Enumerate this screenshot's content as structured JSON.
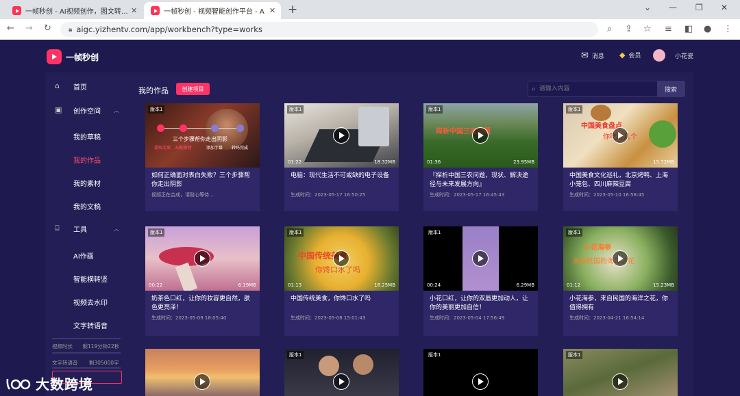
{
  "browser": {
    "tabs": [
      {
        "title": "一帧秒创 - AI视频创作，图文转…"
      },
      {
        "title": "一帧秒创 - 视频智能创作平台 - A"
      }
    ],
    "url": "aigc.yizhentv.com/app/workbench?type=works"
  },
  "app": {
    "brand": "一帧秒创",
    "header": {
      "messages": "消息",
      "member": "会员",
      "username": "小花瓷"
    },
    "sidebar": {
      "home": "首页",
      "creation_space": "创作空间",
      "creation_items": [
        "我的草稿",
        "我的作品",
        "我的素材",
        "我的文稿"
      ],
      "tools": "工具",
      "tool_items": [
        "AI作画",
        "智能横转竖",
        "视频去水印",
        "文字转语音"
      ],
      "quota": [
        {
          "label": "视频时长",
          "value": "剩119分钟22秒"
        },
        {
          "label": "文字转语音",
          "value": "剩305000字"
        }
      ]
    },
    "main": {
      "title": "我的作品",
      "create_button": "创建项目",
      "search_placeholder": "请输入内容",
      "search_button": "搜索"
    },
    "cards": [
      {
        "badge": "版本1",
        "duration": "",
        "size": "",
        "title": "如何正确面对表白失败？三个步骤帮你走出阴影",
        "meta": "视频正在合成，请耐心等待…",
        "overlay_lines": [
          "三个步骤帮你走出阴影"
        ],
        "steps": [
          "提取文案",
          "AI配素材",
          "添加字幕",
          "转码完成"
        ]
      },
      {
        "badge": "版本1",
        "duration": "01:22",
        "size": "18.32MB",
        "title": "电脑：现代生活不可或缺的电子设备",
        "meta": "生成时间：2023-05-17 16:50:25",
        "overlay_lines": []
      },
      {
        "badge": "版本1",
        "duration": "01:36",
        "size": "23.95MB",
        "title": "『探析中国三农问题，现状、解决途径与未来发展方向』",
        "meta": "生成时间：2023-05-17 16:45:43",
        "overlay_lines": [
          "探析中国三农问题"
        ]
      },
      {
        "badge": "版本1",
        "duration": "",
        "size": "15.72MB",
        "title": "中国美食文化巡礼，北京烤鸭、上海小笼包、四川麻辣豆腐",
        "meta": "生成时间：2023-05-10 16:58:45",
        "overlay_lines": [
          "中国美食盘点",
          "你吃过几个"
        ]
      },
      {
        "badge": "版本1",
        "duration": "00:22",
        "size": "6.19MB",
        "title": "奶茶色口红，让你的妆容更自然，肤色更亮泽！",
        "meta": "生成时间：2023-05-09 18:05:40",
        "overlay_lines": []
      },
      {
        "badge": "版本1",
        "duration": "01:13",
        "size": "18.25MB",
        "title": "中国传统美食，你馋口水了吗",
        "meta": "生成时间：2023-05-08 15:01:43",
        "overlay_lines": [
          "中国传统美食",
          "你馋口水了吗"
        ]
      },
      {
        "badge": "版本1",
        "duration": "00:24",
        "size": "6.29MB",
        "title": "小花口红，让你的双唇更加动人，让你的美丽更加自信！",
        "meta": "生成时间：2023-05-04 17:56:49",
        "overlay_lines": []
      },
      {
        "badge": "版本1",
        "duration": "01:12",
        "size": "15.23MB",
        "title": "小花海参，来自民国的海洋之花，你值得拥有",
        "meta": "生成时间：2023-04-21 16:54:14",
        "overlay_lines": [
          "小花海参",
          "来自民国的海洋之花"
        ]
      },
      {
        "badge": "",
        "duration": "",
        "size": "",
        "title": "",
        "meta": "",
        "overlay_lines": []
      },
      {
        "badge": "版本1",
        "duration": "",
        "size": "",
        "title": "",
        "meta": "",
        "overlay_lines": []
      },
      {
        "badge": "版本1",
        "duration": "",
        "size": "",
        "title": "",
        "meta": "",
        "overlay_lines": []
      },
      {
        "badge": "版本1",
        "duration": "",
        "size": "",
        "title": "",
        "meta": "",
        "overlay_lines": []
      }
    ]
  },
  "watermark": "大数跨境",
  "colors": {
    "accent": "#ff3366",
    "bg": "#1e1a4f",
    "panel": "#231e55",
    "card": "#2f2768"
  }
}
